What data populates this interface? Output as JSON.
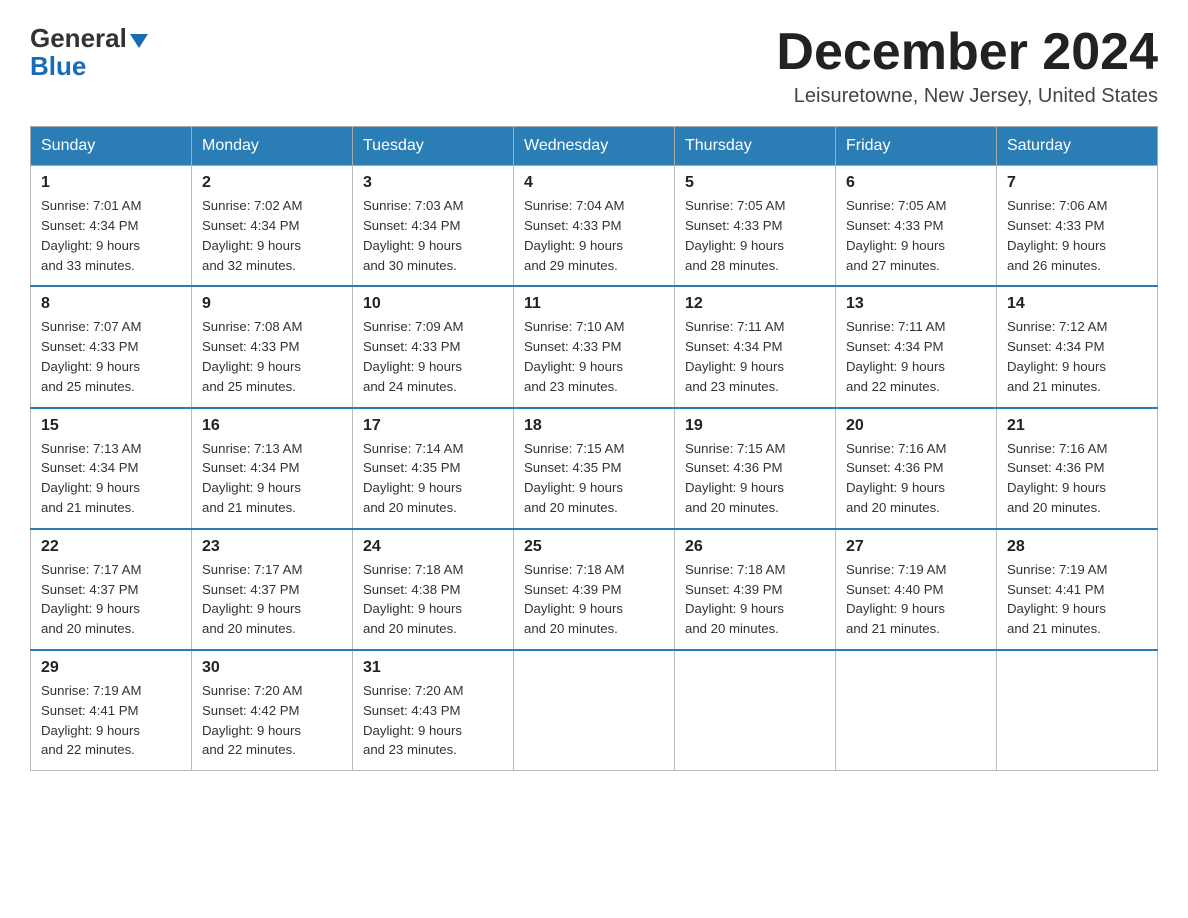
{
  "header": {
    "logo_line1": "General",
    "logo_line2": "Blue",
    "month_title": "December 2024",
    "subtitle": "Leisuretowne, New Jersey, United States"
  },
  "weekdays": [
    "Sunday",
    "Monday",
    "Tuesday",
    "Wednesday",
    "Thursday",
    "Friday",
    "Saturday"
  ],
  "weeks": [
    [
      {
        "day": "1",
        "sunrise": "7:01 AM",
        "sunset": "4:34 PM",
        "daylight": "9 hours and 33 minutes."
      },
      {
        "day": "2",
        "sunrise": "7:02 AM",
        "sunset": "4:34 PM",
        "daylight": "9 hours and 32 minutes."
      },
      {
        "day": "3",
        "sunrise": "7:03 AM",
        "sunset": "4:34 PM",
        "daylight": "9 hours and 30 minutes."
      },
      {
        "day": "4",
        "sunrise": "7:04 AM",
        "sunset": "4:33 PM",
        "daylight": "9 hours and 29 minutes."
      },
      {
        "day": "5",
        "sunrise": "7:05 AM",
        "sunset": "4:33 PM",
        "daylight": "9 hours and 28 minutes."
      },
      {
        "day": "6",
        "sunrise": "7:05 AM",
        "sunset": "4:33 PM",
        "daylight": "9 hours and 27 minutes."
      },
      {
        "day": "7",
        "sunrise": "7:06 AM",
        "sunset": "4:33 PM",
        "daylight": "9 hours and 26 minutes."
      }
    ],
    [
      {
        "day": "8",
        "sunrise": "7:07 AM",
        "sunset": "4:33 PM",
        "daylight": "9 hours and 25 minutes."
      },
      {
        "day": "9",
        "sunrise": "7:08 AM",
        "sunset": "4:33 PM",
        "daylight": "9 hours and 25 minutes."
      },
      {
        "day": "10",
        "sunrise": "7:09 AM",
        "sunset": "4:33 PM",
        "daylight": "9 hours and 24 minutes."
      },
      {
        "day": "11",
        "sunrise": "7:10 AM",
        "sunset": "4:33 PM",
        "daylight": "9 hours and 23 minutes."
      },
      {
        "day": "12",
        "sunrise": "7:11 AM",
        "sunset": "4:34 PM",
        "daylight": "9 hours and 23 minutes."
      },
      {
        "day": "13",
        "sunrise": "7:11 AM",
        "sunset": "4:34 PM",
        "daylight": "9 hours and 22 minutes."
      },
      {
        "day": "14",
        "sunrise": "7:12 AM",
        "sunset": "4:34 PM",
        "daylight": "9 hours and 21 minutes."
      }
    ],
    [
      {
        "day": "15",
        "sunrise": "7:13 AM",
        "sunset": "4:34 PM",
        "daylight": "9 hours and 21 minutes."
      },
      {
        "day": "16",
        "sunrise": "7:13 AM",
        "sunset": "4:34 PM",
        "daylight": "9 hours and 21 minutes."
      },
      {
        "day": "17",
        "sunrise": "7:14 AM",
        "sunset": "4:35 PM",
        "daylight": "9 hours and 20 minutes."
      },
      {
        "day": "18",
        "sunrise": "7:15 AM",
        "sunset": "4:35 PM",
        "daylight": "9 hours and 20 minutes."
      },
      {
        "day": "19",
        "sunrise": "7:15 AM",
        "sunset": "4:36 PM",
        "daylight": "9 hours and 20 minutes."
      },
      {
        "day": "20",
        "sunrise": "7:16 AM",
        "sunset": "4:36 PM",
        "daylight": "9 hours and 20 minutes."
      },
      {
        "day": "21",
        "sunrise": "7:16 AM",
        "sunset": "4:36 PM",
        "daylight": "9 hours and 20 minutes."
      }
    ],
    [
      {
        "day": "22",
        "sunrise": "7:17 AM",
        "sunset": "4:37 PM",
        "daylight": "9 hours and 20 minutes."
      },
      {
        "day": "23",
        "sunrise": "7:17 AM",
        "sunset": "4:37 PM",
        "daylight": "9 hours and 20 minutes."
      },
      {
        "day": "24",
        "sunrise": "7:18 AM",
        "sunset": "4:38 PM",
        "daylight": "9 hours and 20 minutes."
      },
      {
        "day": "25",
        "sunrise": "7:18 AM",
        "sunset": "4:39 PM",
        "daylight": "9 hours and 20 minutes."
      },
      {
        "day": "26",
        "sunrise": "7:18 AM",
        "sunset": "4:39 PM",
        "daylight": "9 hours and 20 minutes."
      },
      {
        "day": "27",
        "sunrise": "7:19 AM",
        "sunset": "4:40 PM",
        "daylight": "9 hours and 21 minutes."
      },
      {
        "day": "28",
        "sunrise": "7:19 AM",
        "sunset": "4:41 PM",
        "daylight": "9 hours and 21 minutes."
      }
    ],
    [
      {
        "day": "29",
        "sunrise": "7:19 AM",
        "sunset": "4:41 PM",
        "daylight": "9 hours and 22 minutes."
      },
      {
        "day": "30",
        "sunrise": "7:20 AM",
        "sunset": "4:42 PM",
        "daylight": "9 hours and 22 minutes."
      },
      {
        "day": "31",
        "sunrise": "7:20 AM",
        "sunset": "4:43 PM",
        "daylight": "9 hours and 23 minutes."
      },
      null,
      null,
      null,
      null
    ]
  ],
  "labels": {
    "sunrise": "Sunrise: ",
    "sunset": "Sunset: ",
    "daylight": "Daylight: "
  }
}
